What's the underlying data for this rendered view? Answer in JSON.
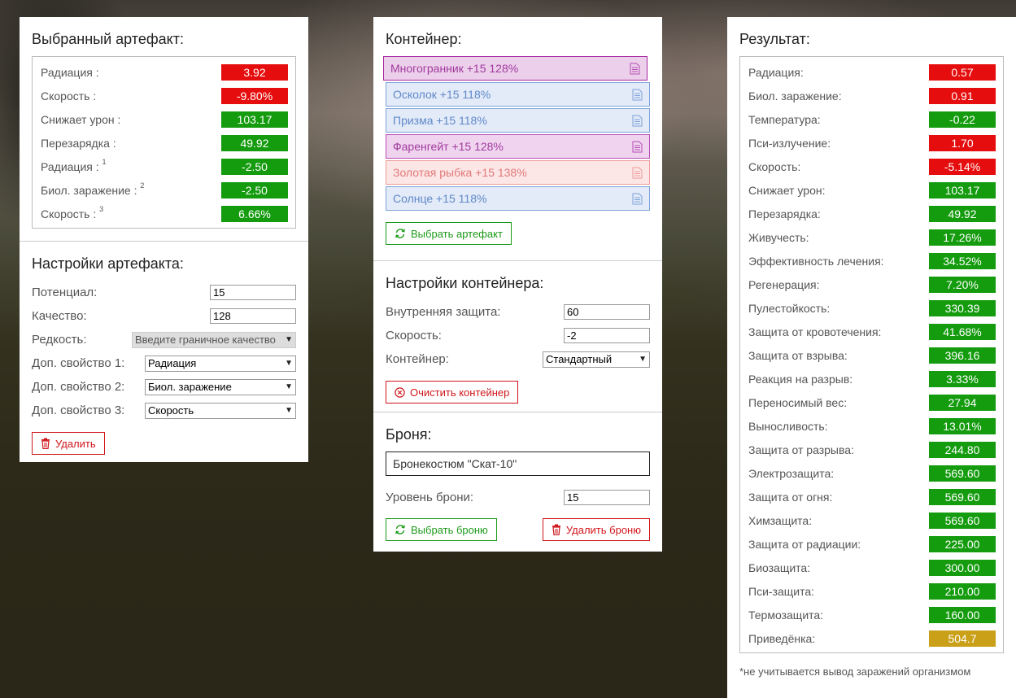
{
  "selected_artifact": {
    "title": "Выбранный артефакт:",
    "stats": [
      {
        "label": "Радиация :",
        "sup": "",
        "value": "3.92",
        "color": "red"
      },
      {
        "label": "Скорость :",
        "sup": "",
        "value": "-9.80%",
        "color": "red"
      },
      {
        "label": "Снижает урон :",
        "sup": "",
        "value": "103.17",
        "color": "green"
      },
      {
        "label": "Перезарядка :",
        "sup": "",
        "value": "49.92",
        "color": "green"
      },
      {
        "label": "Радиация :",
        "sup": "1",
        "value": "-2.50",
        "color": "green"
      },
      {
        "label": "Биол. заражение :",
        "sup": "2",
        "value": "-2.50",
        "color": "green"
      },
      {
        "label": "Скорость :",
        "sup": "3",
        "value": "6.66%",
        "color": "green"
      }
    ]
  },
  "artifact_settings": {
    "title": "Настройки артефакта:",
    "potential_label": "Потенциал:",
    "potential_value": "15",
    "quality_label": "Качество:",
    "quality_value": "128",
    "rarity_label": "Редкость:",
    "rarity_value": "Введите граничное качество",
    "extra1_label": "Доп. свойство 1:",
    "extra1_value": "Радиация",
    "extra2_label": "Доп. свойство 2:",
    "extra2_value": "Биол. заражение",
    "extra3_label": "Доп. свойство 3:",
    "extra3_value": "Скорость",
    "delete_label": "Удалить"
  },
  "container": {
    "title": "Контейнер:",
    "items": [
      {
        "label": "Многогранник +15 128%",
        "style": "purple active"
      },
      {
        "label": "Осколок +15 118%",
        "style": "blue"
      },
      {
        "label": "Призма +15 118%",
        "style": "blue"
      },
      {
        "label": "Фаренгейт +15 128%",
        "style": "purple"
      },
      {
        "label": "Золотая рыбка +15 138%",
        "style": "pink"
      },
      {
        "label": "Солнце +15 118%",
        "style": "blue"
      }
    ],
    "select_artifact_label": "Выбрать артефакт"
  },
  "container_settings": {
    "title": "Настройки контейнера:",
    "inner_protection_label": "Внутренняя защита:",
    "inner_protection_value": "60",
    "speed_label": "Скорость:",
    "speed_value": "-2",
    "container_label": "Контейнер:",
    "container_value": "Стандартный",
    "clear_label": "Очистить контейнер"
  },
  "armor": {
    "title": "Броня:",
    "name": "Бронекостюм \"Скат-10\"",
    "level_label": "Уровень брони:",
    "level_value": "15",
    "select_label": "Выбрать броню",
    "delete_label": "Удалить броню"
  },
  "result": {
    "title": "Результат:",
    "stats": [
      {
        "label": "Радиация:",
        "value": "0.57",
        "color": "red"
      },
      {
        "label": "Биол. заражение:",
        "value": "0.91",
        "color": "red"
      },
      {
        "label": "Температура:",
        "value": "-0.22",
        "color": "green"
      },
      {
        "label": "Пси-излучение:",
        "value": "1.70",
        "color": "red"
      },
      {
        "label": "Скорость:",
        "value": "-5.14%",
        "color": "red"
      },
      {
        "label": "Снижает урон:",
        "value": "103.17",
        "color": "green"
      },
      {
        "label": "Перезарядка:",
        "value": "49.92",
        "color": "green"
      },
      {
        "label": "Живучесть:",
        "value": "17.26%",
        "color": "green"
      },
      {
        "label": "Эффективность лечения:",
        "value": "34.52%",
        "color": "green"
      },
      {
        "label": "Регенерация:",
        "value": "7.20%",
        "color": "green"
      },
      {
        "label": "Пулестойкость:",
        "value": "330.39",
        "color": "green"
      },
      {
        "label": "Защита от кровотечения:",
        "value": "41.68%",
        "color": "green"
      },
      {
        "label": "Защита от взрыва:",
        "value": "396.16",
        "color": "green"
      },
      {
        "label": "Реакция на разрыв:",
        "value": "3.33%",
        "color": "green"
      },
      {
        "label": "Переносимый вес:",
        "value": "27.94",
        "color": "green"
      },
      {
        "label": "Выносливость:",
        "value": "13.01%",
        "color": "green"
      },
      {
        "label": "Защита от разрыва:",
        "value": "244.80",
        "color": "green"
      },
      {
        "label": "Электрозащита:",
        "value": "569.60",
        "color": "green"
      },
      {
        "label": "Защита от огня:",
        "value": "569.60",
        "color": "green"
      },
      {
        "label": "Химзащита:",
        "value": "569.60",
        "color": "green"
      },
      {
        "label": "Защита от радиации:",
        "value": "225.00",
        "color": "green"
      },
      {
        "label": "Биозащита:",
        "value": "300.00",
        "color": "green"
      },
      {
        "label": "Пси-защита:",
        "value": "210.00",
        "color": "green"
      },
      {
        "label": "Термозащита:",
        "value": "160.00",
        "color": "green"
      },
      {
        "label": "Приведёнка:",
        "value": "504.7",
        "color": "gold"
      }
    ],
    "footnote": "*не учитывается вывод заражений организмом"
  },
  "colors": {
    "red": "#e50d0d",
    "green": "#149b0e",
    "gold": "#c9a017",
    "purple": "#b64db3",
    "blue": "#7ea3da",
    "pink": "#ec9a9a"
  },
  "icons": {
    "refresh": "refresh-icon",
    "clear": "circle-x-icon",
    "trash": "trash-icon",
    "doc": "document-icon"
  }
}
